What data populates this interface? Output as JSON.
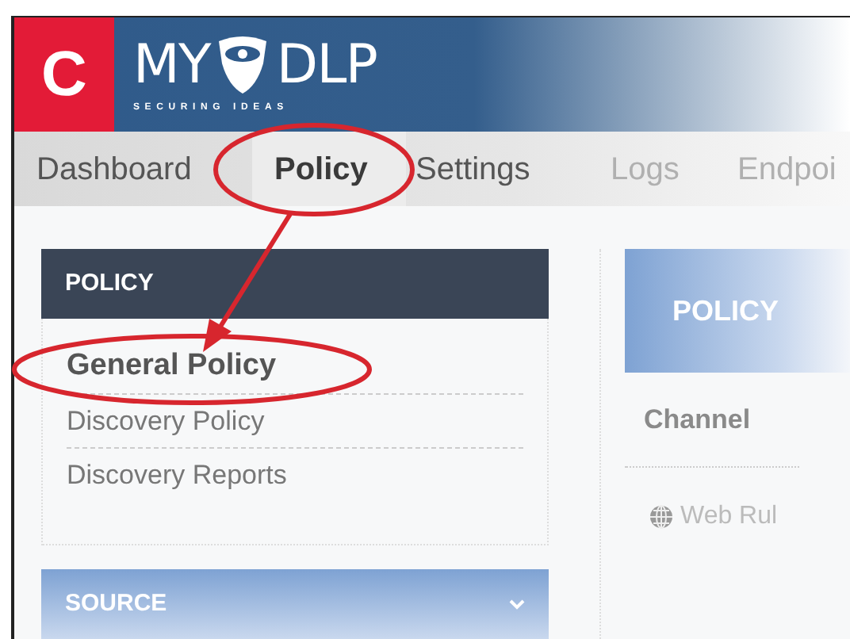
{
  "logo": {
    "letter": "C",
    "name_left": "MY",
    "name_right": "DLP",
    "tagline": "SECURING IDEAS"
  },
  "nav": [
    {
      "label": "Dashboard",
      "selected": false
    },
    {
      "label": "Policy",
      "selected": true
    },
    {
      "label": "Settings",
      "selected": false
    },
    {
      "label": "Logs",
      "selected": false
    },
    {
      "label": "Endpoi",
      "selected": false
    }
  ],
  "sidebar": {
    "sections": [
      {
        "title": "POLICY",
        "expanded": true,
        "items": [
          {
            "label": "General Policy",
            "selected": true
          },
          {
            "label": "Discovery Policy",
            "selected": false
          },
          {
            "label": "Discovery Reports",
            "selected": false
          }
        ]
      },
      {
        "title": "SOURCE",
        "expanded": false
      }
    ]
  },
  "main": {
    "title": "POLICY",
    "heading": "Channel",
    "rules": [
      {
        "label": "Web Rul"
      }
    ]
  }
}
